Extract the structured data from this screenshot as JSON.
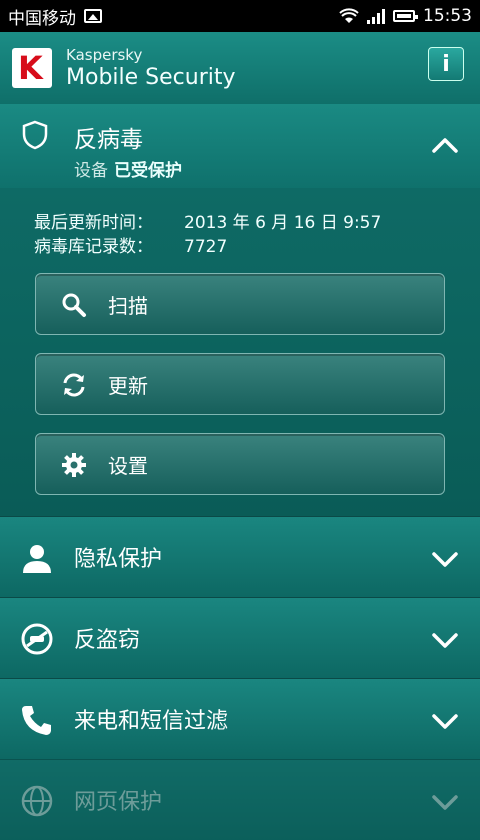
{
  "status_bar": {
    "carrier": "中国移动",
    "time": "15:53"
  },
  "app_bar": {
    "brand_small": "Kaspersky",
    "brand_large": "Mobile Security",
    "logo_letter": "K",
    "info_label": "i"
  },
  "antivirus": {
    "title": "反病毒",
    "status_prefix": "设备",
    "status_value": "已受保护",
    "last_update_label": "最后更新时间：",
    "last_update_value": "2013 年 6 月 16 日 9:57",
    "records_label": "病毒库记录数：",
    "records_value": "7727"
  },
  "buttons": {
    "scan": "扫描",
    "update": "更新",
    "settings": "设置"
  },
  "sections": [
    {
      "label": "隐私保护",
      "icon": "person-icon"
    },
    {
      "label": "反盗窃",
      "icon": "anti-theft-icon"
    },
    {
      "label": "来电和短信过滤",
      "icon": "phone-icon"
    },
    {
      "label": "网页保护",
      "icon": "globe-icon"
    }
  ],
  "colors": {
    "brand_red": "#d70d1b",
    "teal_primary": "#0f6f69"
  }
}
